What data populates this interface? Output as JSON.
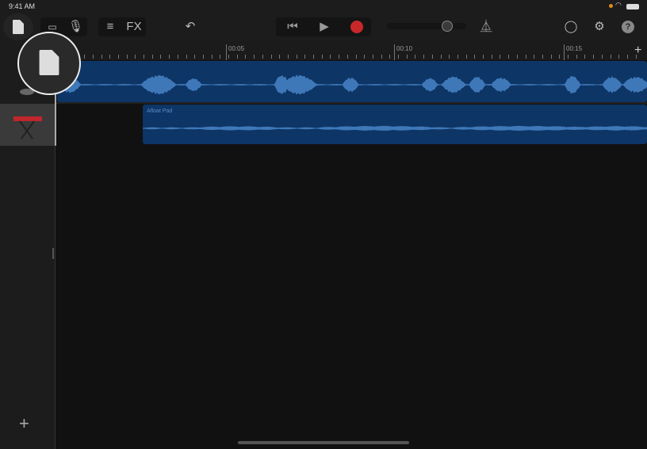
{
  "status": {
    "time": "9:41 AM"
  },
  "toolbar": {
    "fx_label": "FX"
  },
  "ruler": {
    "labels": [
      "00:05",
      "00:10",
      "00:15"
    ]
  },
  "transport": {
    "volume_fraction": 0.76,
    "record_color": "#c8282a"
  },
  "tracks": [
    {
      "instrument": "microphone",
      "region_label": ""
    },
    {
      "instrument": "keyboard",
      "region_label": "Afloat Pad"
    }
  ],
  "colors": {
    "region": "#0d3566",
    "wave": "#3f78b8",
    "accent": "#e08a1e"
  }
}
